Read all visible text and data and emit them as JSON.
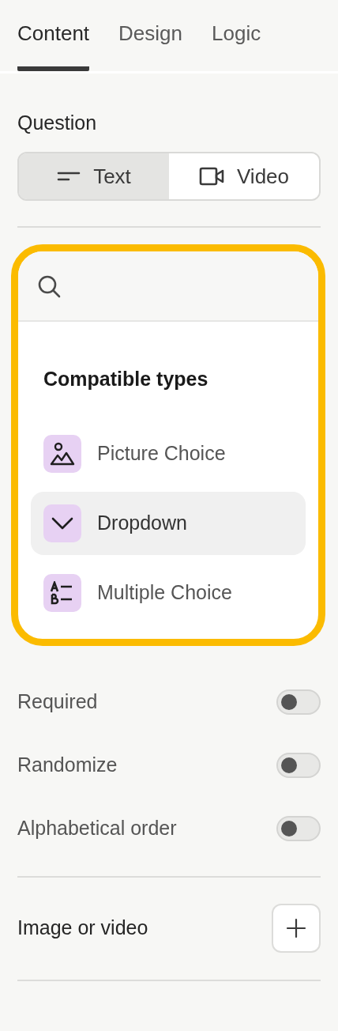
{
  "tabs": [
    {
      "label": "Content",
      "selected": true
    },
    {
      "label": "Design",
      "selected": false
    },
    {
      "label": "Logic",
      "selected": false
    }
  ],
  "question": {
    "heading": "Question",
    "modes": [
      {
        "kind": "text",
        "label": "Text",
        "selected": true
      },
      {
        "kind": "video",
        "label": "Video",
        "selected": false
      }
    ]
  },
  "type_picker": {
    "heading": "Compatible types",
    "items": [
      {
        "kind": "picture",
        "label": "Picture Choice",
        "selected": false
      },
      {
        "kind": "dropdown",
        "label": "Dropdown",
        "selected": true
      },
      {
        "kind": "multiple",
        "label": "Multiple Choice",
        "selected": false
      }
    ]
  },
  "settings": [
    {
      "label": "Required",
      "on": false
    },
    {
      "label": "Randomize",
      "on": false
    },
    {
      "label": "Alphabetical order",
      "on": false
    }
  ],
  "media": {
    "label": "Image or video"
  }
}
